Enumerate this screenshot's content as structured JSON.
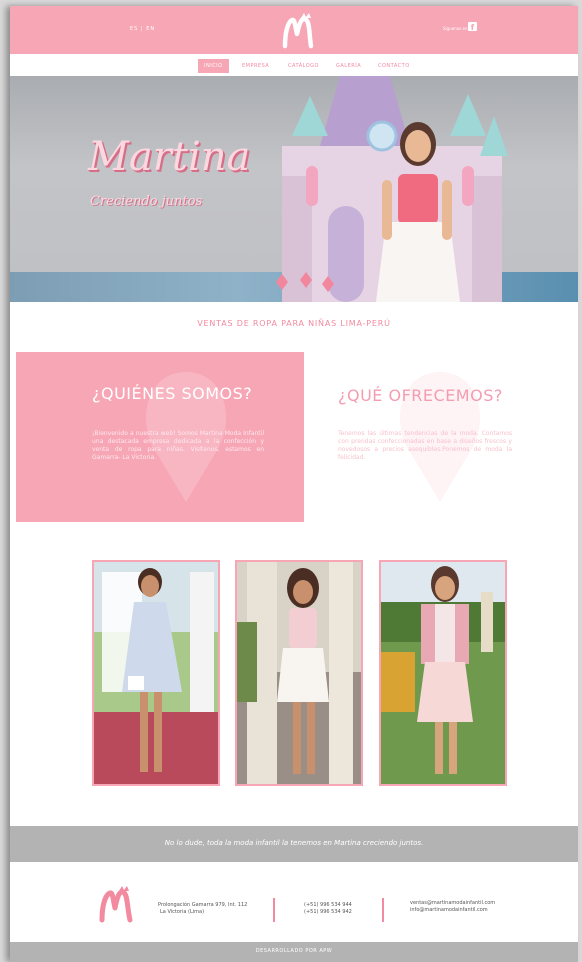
{
  "header": {
    "lang": "ES | EN",
    "follow": "Síguenos en",
    "facebook_glyph": "f"
  },
  "nav": {
    "items": [
      "INICIO",
      "EMPRESA",
      "CATÁLOGO",
      "GALERÍA",
      "CONTACTO"
    ],
    "active": "INICIO"
  },
  "hero": {
    "title": "Martina",
    "subtitle": "Creciendo juntos"
  },
  "sales_heading": "VENTAS DE ROPA PARA NIÑAS LIMA-PERÚ",
  "about": {
    "title": "¿QUIÉNES SOMOS?",
    "text": "¡Bienvenido a nuestra web! Somos Martina Moda Infantil una destacada empresa dedicada a la confección y venta de ropa para niñas. Visítenos, estamos en Gamarra- La Victoria."
  },
  "offer": {
    "title": "¿QUÉ OFRECEMOS?",
    "text": "Tenemos las últimas tendencias de la moda. Contamos con prendas confeccionadas en base a diseños frescos y novedosos a precios asequibles.Ponemos de moda la felicidad."
  },
  "band_text": "No lo dude, toda la moda infantil la tenemos en Martina creciendo juntos.",
  "footer": {
    "address_line1": "Prolongación Gamarra 979, Int. 112",
    "address_line2": "La Victoria (Lima)",
    "phone1": "(+51) 996 534 944",
    "phone2": "(+51) 996 534 942",
    "email1": "ventas@martinamodainfantil.com",
    "email2": "info@martinamodainfantil.com"
  },
  "bottom_text": "DESARROLLADO POR APW",
  "colors": {
    "brand_pink": "#f7a6b6",
    "accent_pink": "#f28aa0",
    "gray_band": "#b4b3b3"
  }
}
